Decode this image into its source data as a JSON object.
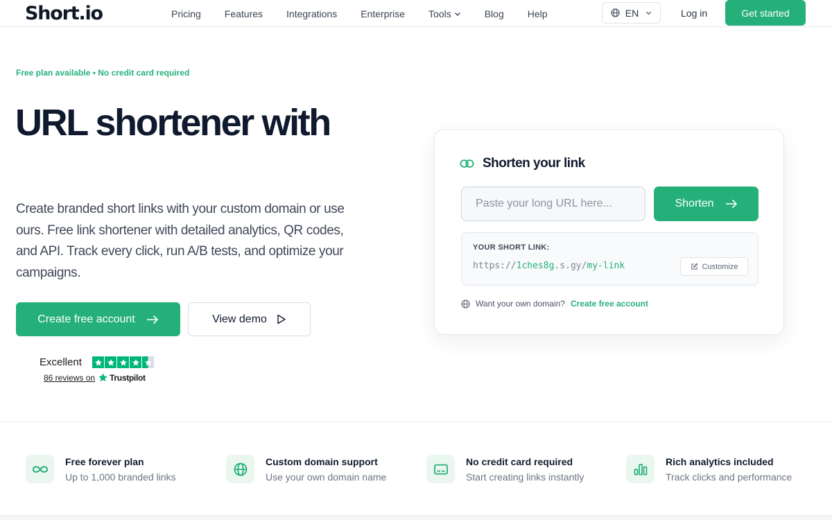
{
  "nav": {
    "logo_first": "S",
    "logo_rest": "hort.io",
    "links": [
      "Pricing",
      "Features",
      "Integrations",
      "Enterprise",
      "Tools",
      "Blog",
      "Help"
    ],
    "language": "EN",
    "login": "Log in",
    "get_started": "Get started"
  },
  "hero": {
    "badge": "Free plan available • No credit card required",
    "title": "URL shortener with",
    "description": "Create branded short links with your custom domain or use ours. Free link shortener with detailed analytics, QR codes, and API. Track every click, run A/B tests, and optimize your campaigns.",
    "primary_cta": "Create free account",
    "secondary_cta": "View demo"
  },
  "trustpilot": {
    "rating_label": "Excellent",
    "reviews": "86 reviews on",
    "brand": "Trustpilot",
    "stars": 4.5
  },
  "card": {
    "title": "Shorten your link",
    "input_placeholder": "Paste your long URL here...",
    "shorten_label": "Shorten",
    "result_label": "YOUR SHORT LINK:",
    "result_prefix": "https://",
    "result_domain": "1ches8g",
    "result_sep1": ".",
    "result_host": "s.gy",
    "result_sep2": "/",
    "result_path": "my-link",
    "customize_label": "Customize",
    "domain_prompt": "Want your own domain?",
    "domain_link": "Create free account"
  },
  "features": [
    {
      "title": "Free forever plan",
      "subtitle": "Up to 1,000 branded links",
      "icon": "infinity-icon"
    },
    {
      "title": "Custom domain support",
      "subtitle": "Use your own domain name",
      "icon": "globe-icon"
    },
    {
      "title": "No credit card required",
      "subtitle": "Start creating links instantly",
      "icon": "credit-card-icon"
    },
    {
      "title": "Rich analytics included",
      "subtitle": "Track clicks and performance",
      "icon": "bar-chart-icon"
    }
  ],
  "colors": {
    "brand_green": "#25b07a",
    "text_dark": "#0f1a2e",
    "trustpilot_green": "#00b67a"
  }
}
